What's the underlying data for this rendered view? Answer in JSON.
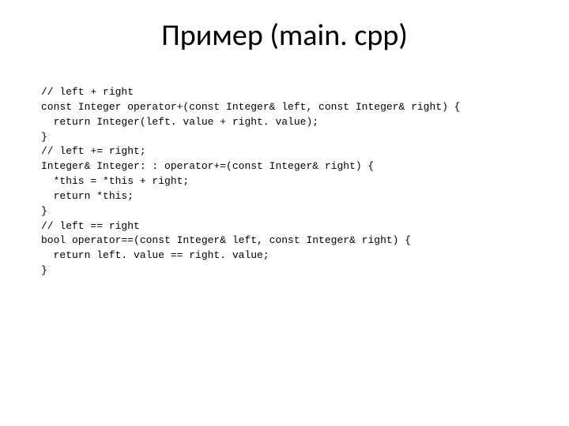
{
  "title": "Пример (main. cpp)",
  "code": {
    "l1": "// left + right",
    "l2": "const Integer operator+(const Integer& left, const Integer& right) {",
    "l3": "  return Integer(left. value + right. value);",
    "l4": "}",
    "l5": "// left += right;",
    "l6": "Integer& Integer: : operator+=(const Integer& right) {",
    "l7": "  *this = *this + right;",
    "l8": "  return *this;",
    "l9": "}",
    "l10": "// left == right",
    "l11": "bool operator==(const Integer& left, const Integer& right) {",
    "l12": "  return left. value == right. value;",
    "l13": "}"
  }
}
